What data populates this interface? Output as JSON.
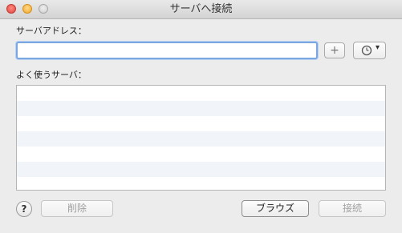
{
  "window": {
    "title": "サーバへ接続"
  },
  "server_address": {
    "label": "サーバアドレス：",
    "value": "",
    "placeholder": ""
  },
  "add_button": {
    "label": "+"
  },
  "recent_menu": {
    "icon": "clock-icon",
    "arrow": "▾"
  },
  "favorites": {
    "label": "よく使うサーバ：",
    "items": []
  },
  "footer": {
    "help_label": "?",
    "remove_label": "削除",
    "browse_label": "ブラウズ",
    "connect_label": "接続"
  }
}
